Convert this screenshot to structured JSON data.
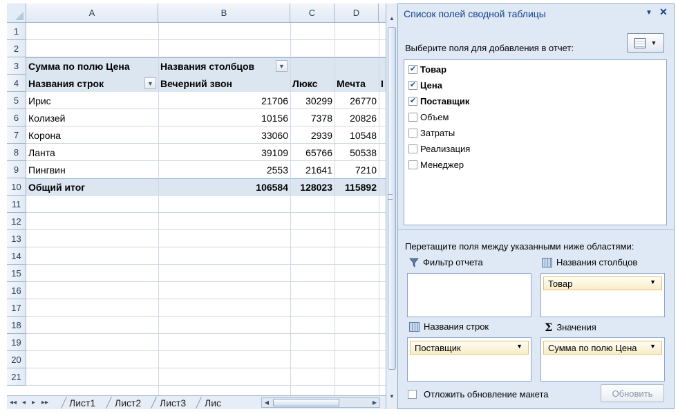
{
  "spreadsheet": {
    "columns": [
      "A",
      "B",
      "C",
      "D"
    ],
    "rows": [
      "1",
      "2",
      "3",
      "4",
      "5",
      "6",
      "7",
      "8",
      "9",
      "10",
      "11",
      "12",
      "13",
      "14",
      "15",
      "16",
      "17",
      "18",
      "19",
      "20",
      "21"
    ],
    "pivot": {
      "value_label": "Сумма по полю Цена",
      "col_labels_caption": "Названия столбцов",
      "row_labels_caption": "Названия строк",
      "col_items": [
        "Вечерний звон",
        "Люкс",
        "Мечта"
      ],
      "col_item_cut": "I",
      "data": [
        {
          "name": "Ирис",
          "v": [
            "21706",
            "30299",
            "26770"
          ]
        },
        {
          "name": "Колизей",
          "v": [
            "10156",
            "7378",
            "20826"
          ]
        },
        {
          "name": "Корона",
          "v": [
            "33060",
            "2939",
            "10548"
          ]
        },
        {
          "name": "Ланта",
          "v": [
            "39109",
            "65766",
            "50538"
          ]
        },
        {
          "name": "Пингвин",
          "v": [
            "2553",
            "21641",
            "7210"
          ]
        }
      ],
      "total": {
        "name": "Общий итог",
        "v": [
          "106584",
          "128023",
          "115892"
        ]
      }
    }
  },
  "sheet_tabs": {
    "nav": [
      "◂◂",
      "◂",
      "▸",
      "▸▸"
    ],
    "tabs": [
      "Лист1",
      "Лист2",
      "Лист3",
      "Лис"
    ]
  },
  "pivot_pane": {
    "title": "Список полей сводной таблицы",
    "choose_label": "Выберите поля для добавления в отчет:",
    "fields": [
      {
        "label": "Товар",
        "checked": true
      },
      {
        "label": "Цена",
        "checked": true
      },
      {
        "label": "Поставщик",
        "checked": true
      },
      {
        "label": "Объем",
        "checked": false
      },
      {
        "label": "Затраты",
        "checked": false
      },
      {
        "label": "Реализация",
        "checked": false
      },
      {
        "label": "Менеджер",
        "checked": false
      }
    ],
    "drag_label": "Перетащите поля между указанными ниже областями:",
    "areas": {
      "filter": {
        "label": "Фильтр отчета",
        "icon": "filter-icon"
      },
      "columns": {
        "label": "Названия столбцов",
        "icon": "grid-icon",
        "chip": "Товар"
      },
      "rows": {
        "label": "Названия строк",
        "icon": "grid-icon",
        "chip": "Поставщик"
      },
      "values": {
        "label": "Значения",
        "icon": "sigma-icon",
        "chip": "Сумма по полю Цена"
      }
    },
    "defer_label": "Отложить обновление макета",
    "update_label": "Обновить"
  },
  "colors": {
    "pivot_band": "#dbe6f1",
    "header_blue": "#15428b",
    "chip_fill": "#f9ecc7"
  }
}
